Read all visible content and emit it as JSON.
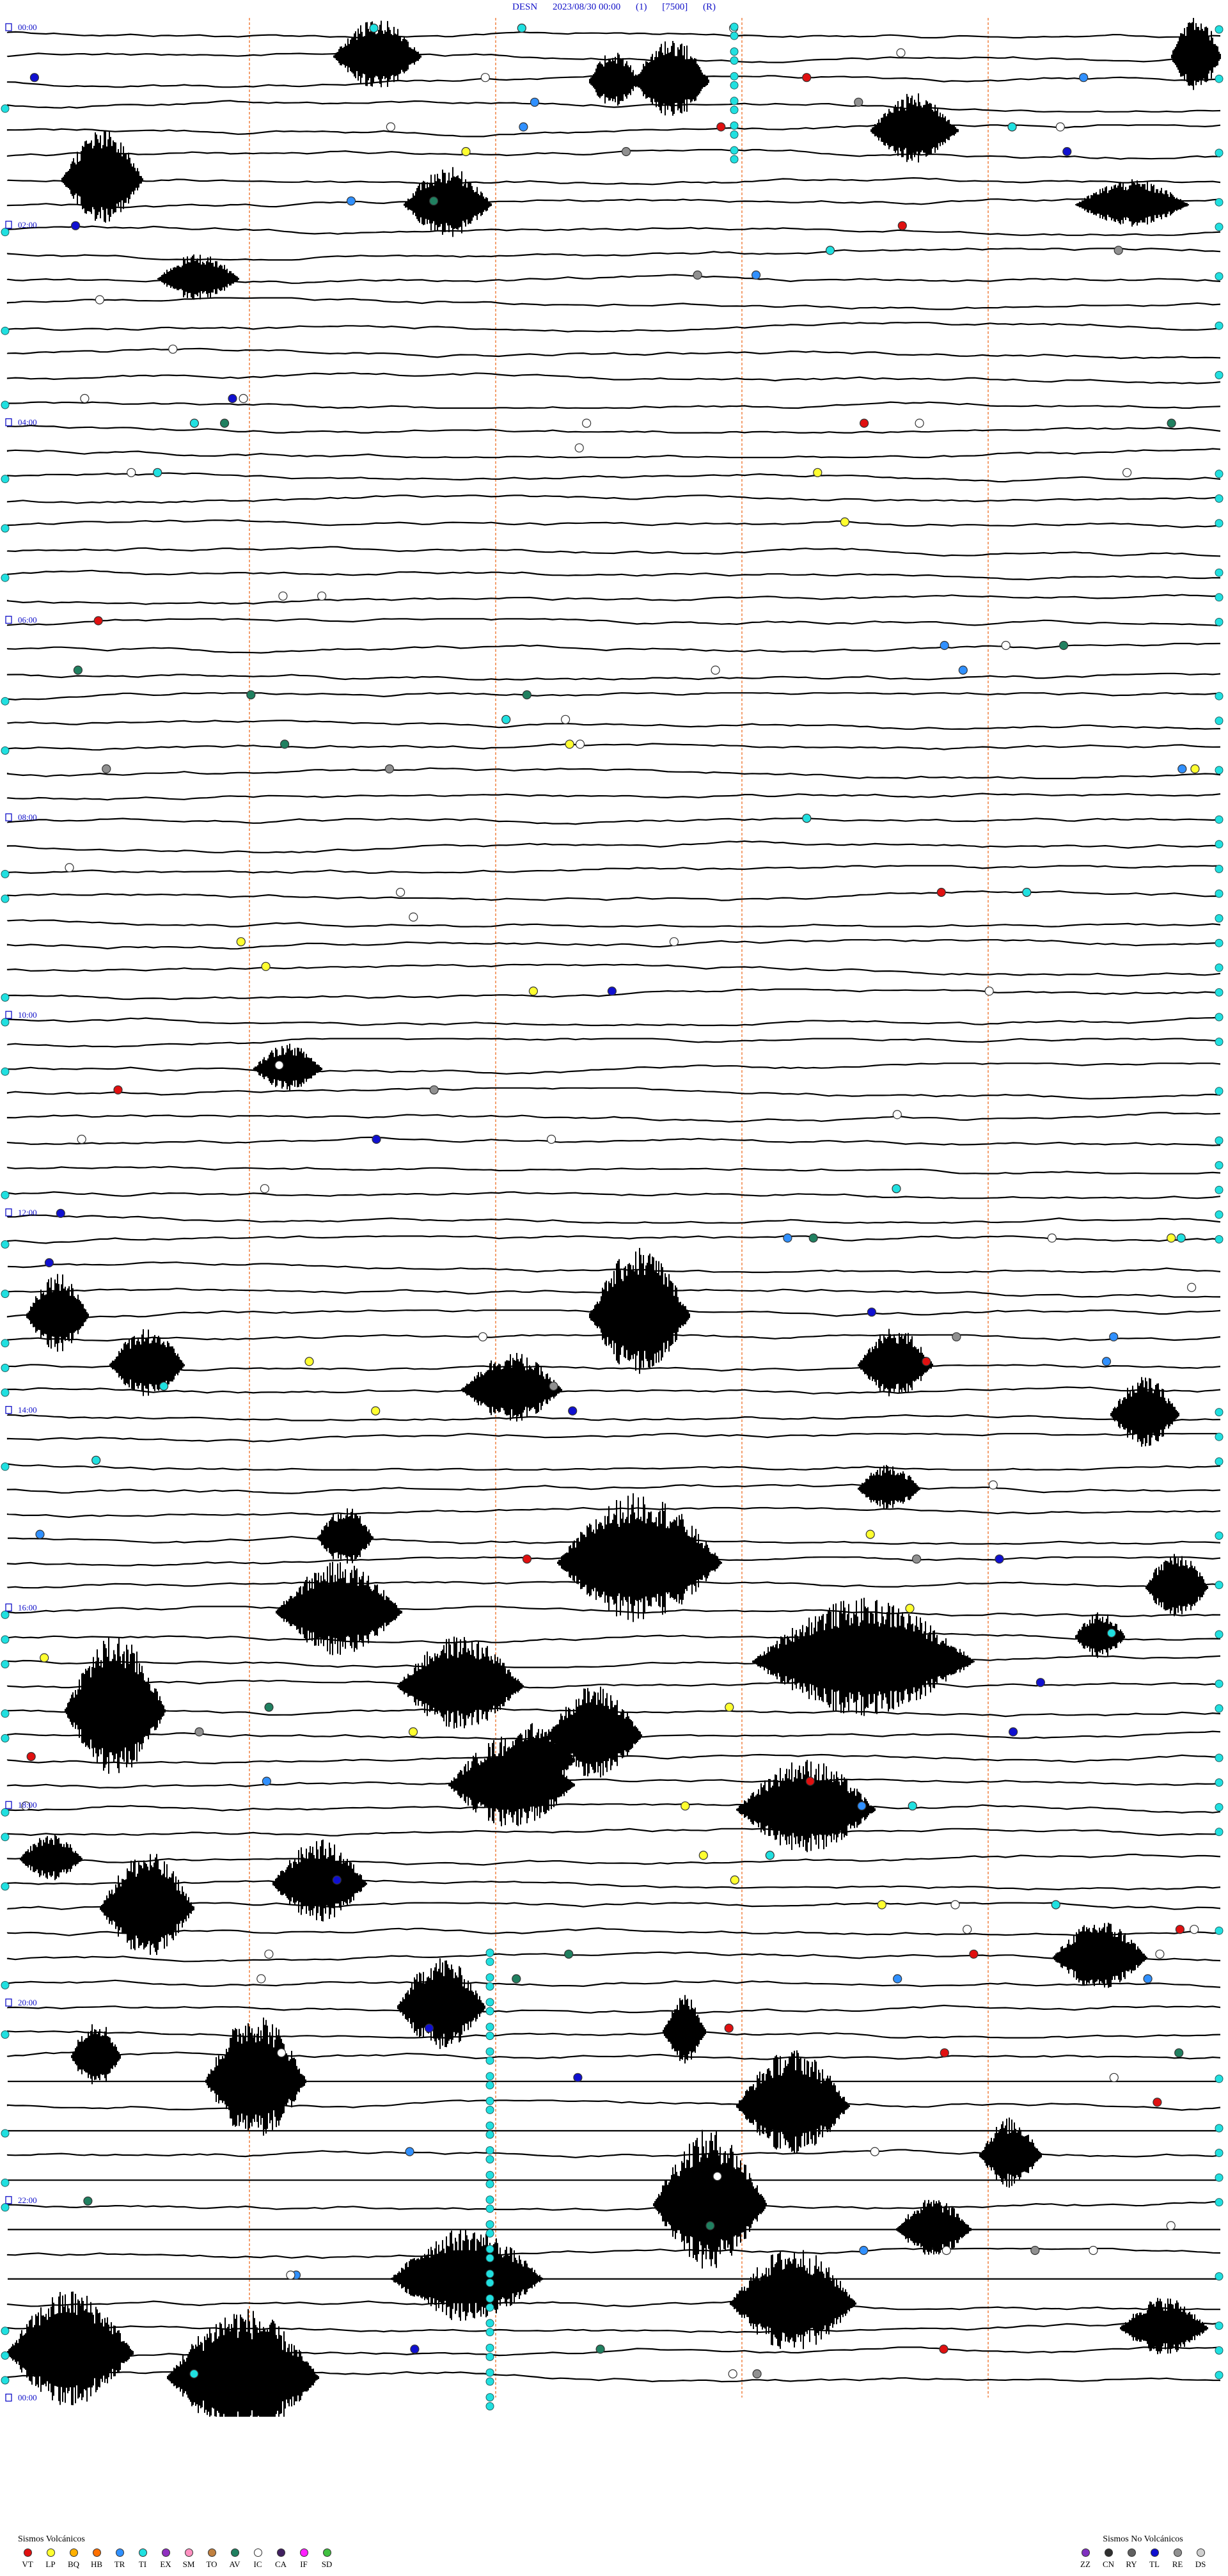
{
  "header": {
    "station": "DESN",
    "datetime": "2023/08/30 00:00",
    "channel": "(1)",
    "scale": "[7500]",
    "filter": "(R)"
  },
  "time_labels": [
    "00:00",
    "02:00",
    "04:00",
    "06:00",
    "08:00",
    "10:00",
    "12:00",
    "14:00",
    "16:00",
    "18:00",
    "20:00",
    "22:00",
    "00:00"
  ],
  "legend_volcanic": {
    "title": "Sismos Volcánicos",
    "items": [
      {
        "code": "VT",
        "color": "#e01010"
      },
      {
        "code": "LP",
        "color": "#ffff30"
      },
      {
        "code": "BQ",
        "color": "#ffb000"
      },
      {
        "code": "HB",
        "color": "#ff7000"
      },
      {
        "code": "TR",
        "color": "#3090ff"
      },
      {
        "code": "TI",
        "color": "#20e0e0"
      },
      {
        "code": "EX",
        "color": "#9030c0"
      },
      {
        "code": "SM",
        "color": "#ff90c0"
      },
      {
        "code": "TO",
        "color": "#c08040"
      },
      {
        "code": "AV",
        "color": "#208060"
      },
      {
        "code": "IC",
        "color": "#ffffff"
      },
      {
        "code": "CA",
        "color": "#402060"
      },
      {
        "code": "IF",
        "color": "#ff20ff"
      },
      {
        "code": "SD",
        "color": "#40c040"
      }
    ]
  },
  "legend_nonvolcanic": {
    "title": "Sismos No Volcánicos",
    "items": [
      {
        "code": "ZZ",
        "color": "#8030c0"
      },
      {
        "code": "CN",
        "color": "#303030"
      },
      {
        "code": "RY",
        "color": "#606060"
      },
      {
        "code": "TL",
        "color": "#1010d0"
      },
      {
        "code": "RE",
        "color": "#909090"
      },
      {
        "code": "DS",
        "color": "#d0d0d0"
      }
    ]
  }
}
